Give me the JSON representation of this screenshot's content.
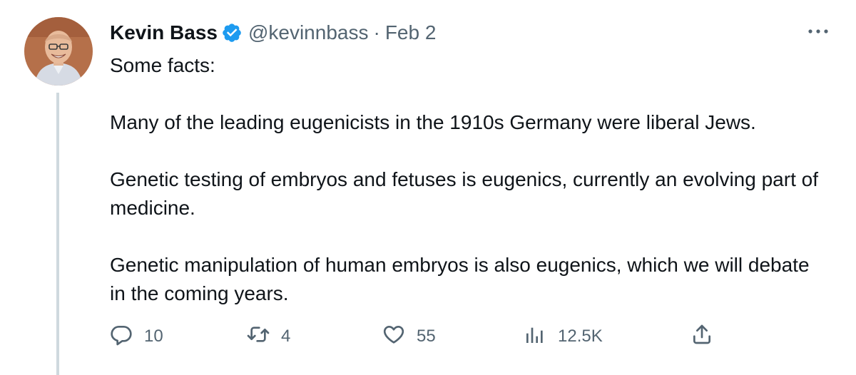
{
  "author": {
    "display_name": "Kevin Bass",
    "handle": "@kevinnbass",
    "separator": "·",
    "date": "Feb 2",
    "verified_color": "#1d9bf0"
  },
  "tweet": {
    "paragraphs": [
      "Some facts:",
      "Many of the leading eugenicists in the 1910s Germany were liberal Jews.",
      "Genetic testing of embryos and fetuses is eugenics, currently an evolving part of medicine.",
      "Genetic manipulation of human embryos is also eugenics, which we will debate in the coming years."
    ]
  },
  "actions": {
    "replies": "10",
    "retweets": "4",
    "likes": "55",
    "views": "12.5K"
  },
  "icons": {
    "more": "more-horizontal-icon",
    "reply": "reply-icon",
    "retweet": "retweet-icon",
    "like": "heart-icon",
    "views": "analytics-icon",
    "share": "share-icon",
    "verified": "verified-badge-icon"
  }
}
